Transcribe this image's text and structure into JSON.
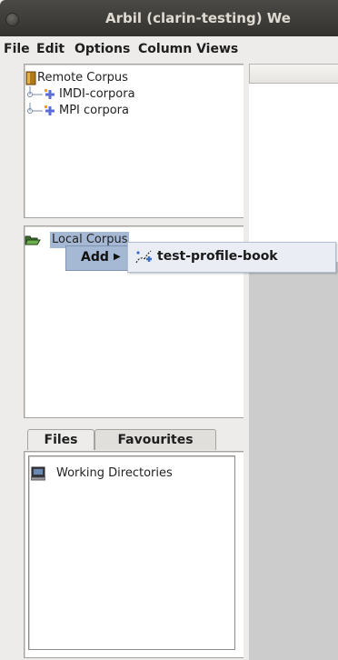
{
  "window": {
    "title": "Arbil (clarin-testing) We"
  },
  "menubar": {
    "items": [
      "File",
      "Edit",
      "Options",
      "Column Views"
    ]
  },
  "remote_tree": {
    "root_label": "Remote Corpus",
    "children": [
      "IMDI-corpora",
      "MPI corpora"
    ]
  },
  "local_tree": {
    "root_label": "Local Corpus"
  },
  "context_menu": {
    "add_label": "Add",
    "submenu_item": "test-profile-book"
  },
  "files_panel": {
    "tabs": [
      "Files",
      "Favourites"
    ],
    "root_label": "Working Directories"
  },
  "colors": {
    "titlebar": "#3d3c38",
    "selection": "#a5b8d4",
    "grey_area": "#cccccc"
  }
}
